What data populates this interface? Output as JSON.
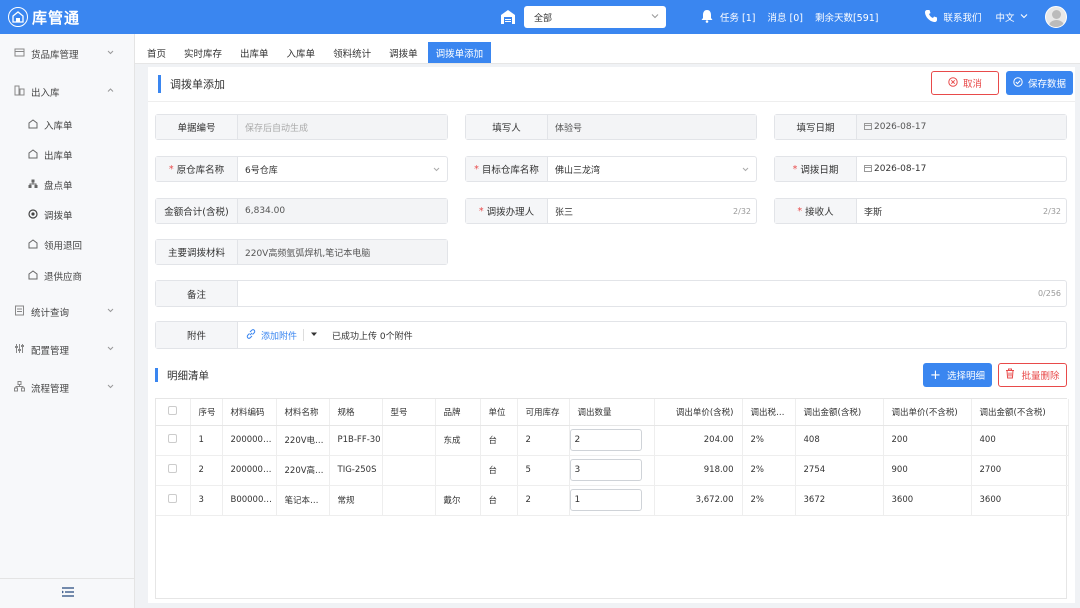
{
  "header": {
    "app_title": "库管通",
    "warehouse_select": "全部",
    "tasks": "任务 [1]",
    "messages": "消息 [0]",
    "days_left": "剩余天数[591]",
    "contact": "联系我们",
    "language": "中文"
  },
  "sidebar": {
    "groups": [
      {
        "label": "货品库管理"
      },
      {
        "label": "出入库"
      },
      {
        "label": "统计查询"
      },
      {
        "label": "配置管理"
      },
      {
        "label": "流程管理"
      }
    ],
    "sub_items": [
      {
        "label": "入库单"
      },
      {
        "label": "出库单"
      },
      {
        "label": "盘点单"
      },
      {
        "label": "调拨单"
      },
      {
        "label": "领用退回"
      },
      {
        "label": "退供应商"
      }
    ]
  },
  "tabs": [
    {
      "label": "首页"
    },
    {
      "label": "实时库存"
    },
    {
      "label": "出库单"
    },
    {
      "label": "入库单"
    },
    {
      "label": "领料统计"
    },
    {
      "label": "调拨单"
    },
    {
      "label": "调拨单添加"
    }
  ],
  "page": {
    "title": "调拨单添加",
    "cancel": "取消",
    "save": "保存数据"
  },
  "form": {
    "doc_no_label": "单据编号",
    "doc_no_placeholder": "保存后自动生成",
    "filler_label": "填写人",
    "filler_value": "体验号",
    "fill_date_label": "填写日期",
    "fill_date_value": "2026-08-17",
    "src_wh_label": "原仓库名称",
    "src_wh_value": "6号仓库",
    "dst_wh_label": "目标仓库名称",
    "dst_wh_value": "佛山三龙湾",
    "transfer_date_label": "调拨日期",
    "transfer_date_value": "2026-08-17",
    "amount_label": "金额合计(含税)",
    "amount_value": "6,834.00",
    "handler_label": "调拨办理人",
    "handler_value": "张三",
    "handler_count": "2/32",
    "receiver_label": "接收人",
    "receiver_value": "李斯",
    "receiver_count": "2/32",
    "materials_label": "主要调拨材料",
    "materials_value": "220V高频氩弧焊机,笔记本电脑",
    "remark_label": "备注",
    "remark_count": "0/256",
    "attach_label": "附件",
    "attach_button": "添加附件",
    "attach_status": "已成功上传 0个附件"
  },
  "detail": {
    "title": "明细清单",
    "pick_button": "选择明细",
    "batch_delete_button": "批量删除",
    "columns": [
      "序号",
      "材料编码",
      "材料名称",
      "规格",
      "型号",
      "品牌",
      "单位",
      "可用库存",
      "调出数量",
      "调出单价(含税)",
      "调出税…",
      "调出金额(含税)",
      "调出单价(不含税)",
      "调出金额(不含税)"
    ],
    "rows": [
      {
        "no": "1",
        "code": "200000…",
        "name": "220V电…",
        "spec": "P1B-FF-30",
        "model": "",
        "brand": "东成",
        "unit": "台",
        "stock": "2",
        "qty": "2",
        "price_tax": "204.00",
        "tax": "2%",
        "amount_tax": "408",
        "price_notax": "200",
        "amount_notax": "400"
      },
      {
        "no": "2",
        "code": "200000…",
        "name": "220V高…",
        "spec": "TIG-250S",
        "model": "",
        "brand": "",
        "unit": "台",
        "stock": "5",
        "qty": "3",
        "price_tax": "918.00",
        "tax": "2%",
        "amount_tax": "2754",
        "price_notax": "900",
        "amount_notax": "2700"
      },
      {
        "no": "3",
        "code": "B00000…",
        "name": "笔记本…",
        "spec": "常规",
        "model": "",
        "brand": "戴尔",
        "unit": "台",
        "stock": "2",
        "qty": "1",
        "price_tax": "3,672.00",
        "tax": "2%",
        "amount_tax": "3672",
        "price_notax": "3600",
        "amount_notax": "3600"
      }
    ]
  },
  "colors": {
    "primary": "#3a86f0",
    "danger": "#e84a4a"
  }
}
